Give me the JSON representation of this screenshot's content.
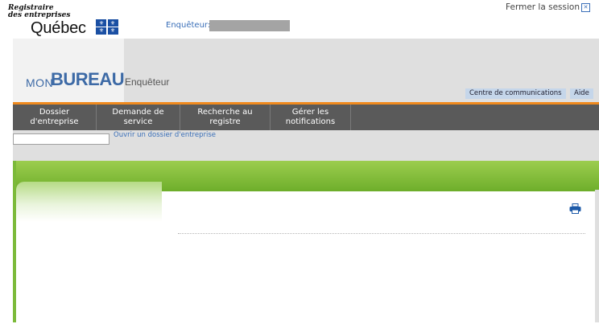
{
  "header": {
    "registry_line1": "Registraire",
    "registry_line2": "des entreprises",
    "quebec": "Québec",
    "investigator_label": "Enquêteur:",
    "investigator_value": "",
    "logout": "Fermer la session"
  },
  "brand": {
    "mon": "MON",
    "bureau": "BUREAU",
    "role": "Enquêteur"
  },
  "utility_links": {
    "communications": "Centre de communications",
    "help": "Aide"
  },
  "nav": {
    "dossier_l1": "Dossier",
    "dossier_l2": "d'entreprise",
    "demande_l1": "Demande de",
    "demande_l2": "service",
    "recherche_l1": "Recherche au",
    "recherche_l2": "registre",
    "gerer_l1": "Gérer les",
    "gerer_l2": "notifications"
  },
  "quick_open": {
    "input_value": "",
    "link": "Ouvrir un dossier d'entreprise"
  },
  "colors": {
    "accent_orange": "#f08a1e",
    "nav_grey": "#5a5a5a",
    "green": "#6eae2b",
    "link_blue": "#3a6fb8"
  },
  "icons": {
    "print": "printer-icon",
    "logout": "close-box-icon",
    "flag": "quebec-flag-icon"
  }
}
